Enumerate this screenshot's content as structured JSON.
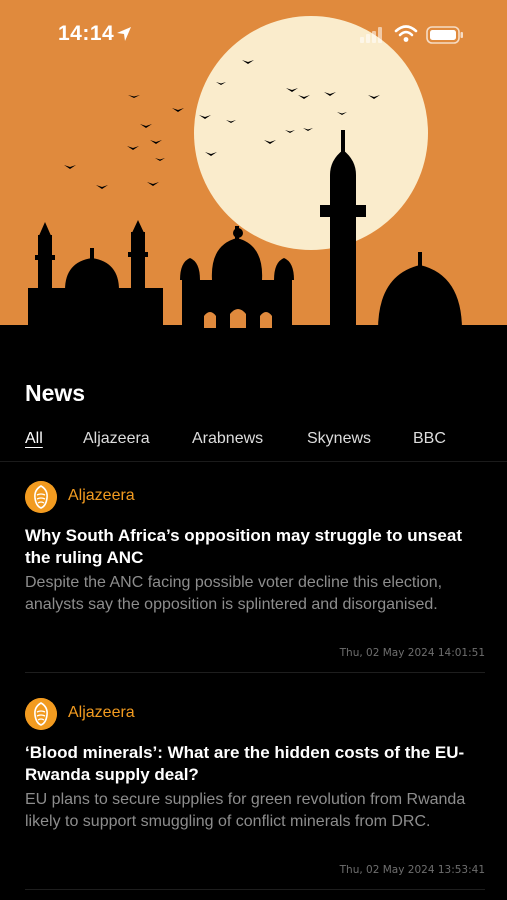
{
  "status_bar": {
    "time": "14:14",
    "location_icon": "location-arrow-icon",
    "signal_icon": "cellular-signal-icon",
    "wifi_icon": "wifi-icon",
    "battery_icon": "battery-icon"
  },
  "header": {
    "illustration": "mosque-skyline-with-sun-and-birds",
    "colors": {
      "sky": "#e08a3d",
      "sun": "#faeccc",
      "silhouette": "#000000"
    }
  },
  "page": {
    "title": "News"
  },
  "tabs": [
    {
      "label": "All",
      "active": true
    },
    {
      "label": "Aljazeera",
      "active": false
    },
    {
      "label": "Arabnews",
      "active": false
    },
    {
      "label": "Skynews",
      "active": false
    },
    {
      "label": "BBC",
      "active": false
    }
  ],
  "articles": [
    {
      "source": "Aljazeera",
      "source_icon": "aljazeera-logo-icon",
      "headline": "Why South Africa’s opposition may struggle to unseat the ruling ANC",
      "summary": "Despite the ANC facing possible voter decline this election, analysts say the opposition is splintered and disorganised.",
      "timestamp": "Thu, 02 May 2024 14:01:51"
    },
    {
      "source": "Aljazeera",
      "source_icon": "aljazeera-logo-icon",
      "headline": "‘Blood minerals’: What are the hidden costs of the EU-Rwanda supply deal?",
      "summary": "EU plans to secure supplies for green revolution from Rwanda likely to support smuggling of conflict minerals from DRC.",
      "timestamp": "Thu, 02 May 2024 13:53:41"
    }
  ],
  "theme": {
    "accent": "#f29b20",
    "background": "#000000",
    "muted_text": "#8d8d8d"
  }
}
